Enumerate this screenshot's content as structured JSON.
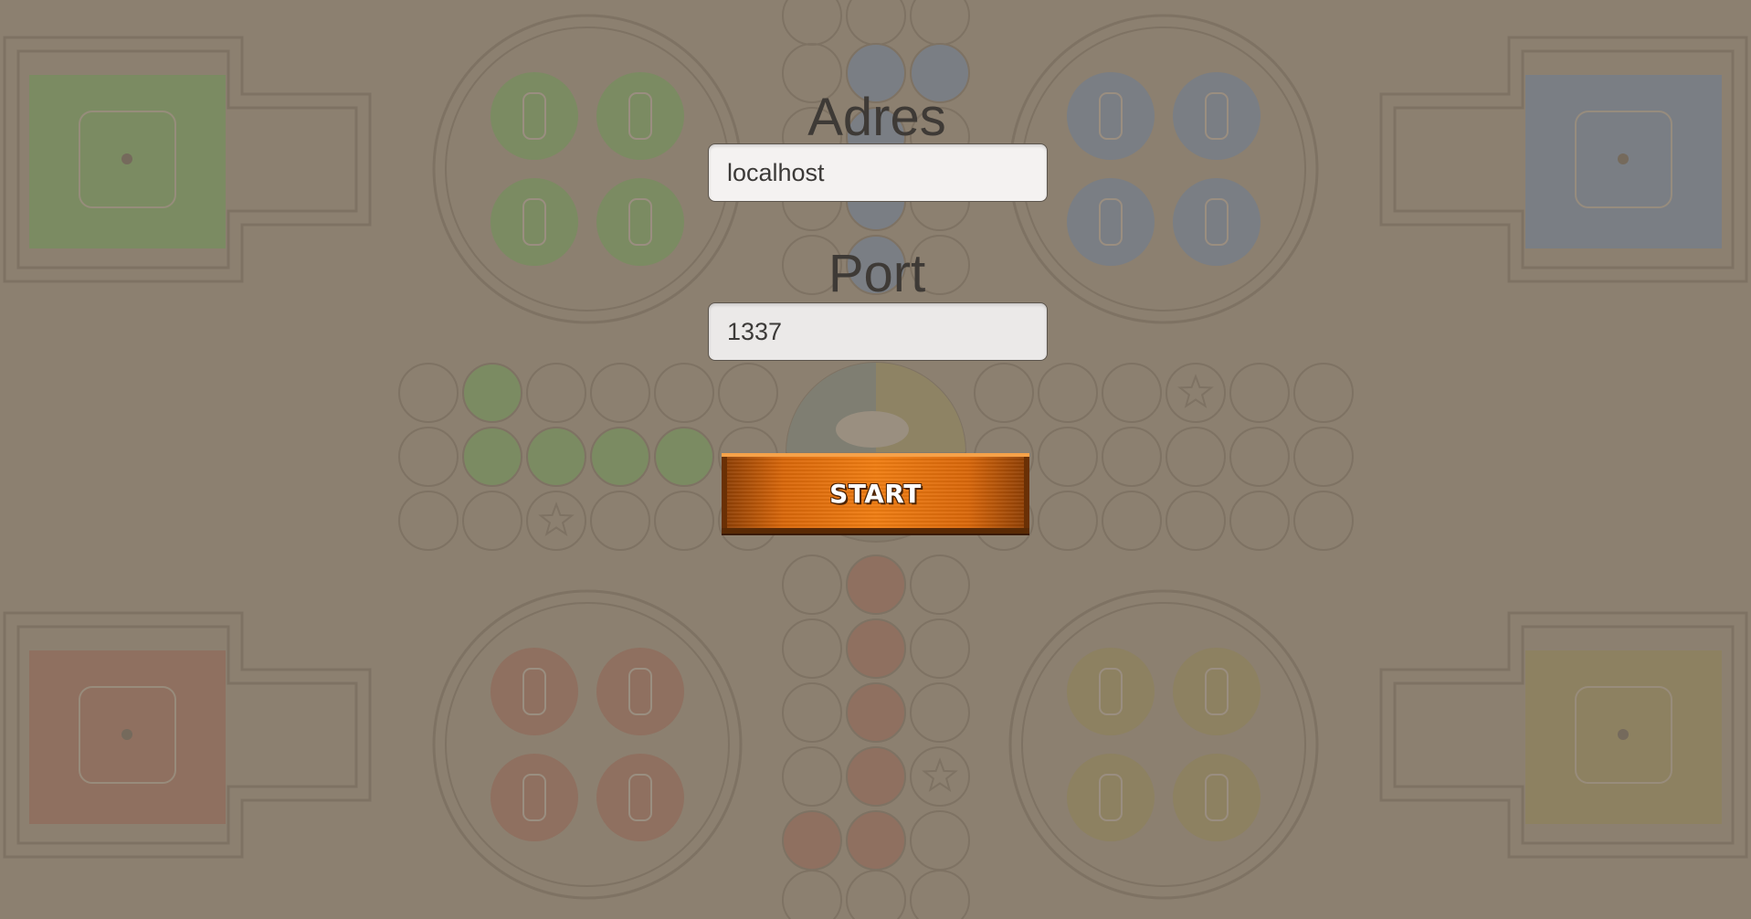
{
  "form": {
    "address_label": "Adres",
    "address_value": "localhost",
    "port_label": "Port",
    "port_value": "1337",
    "start_label": "START"
  },
  "board": {
    "colors": {
      "background": "#8c8070",
      "outline": "#7e7263",
      "green": "#7b8b62",
      "blue": "#7a7e84",
      "red": "#8f7060",
      "yellow": "#8d8161",
      "start_button": "#f07d12"
    }
  }
}
